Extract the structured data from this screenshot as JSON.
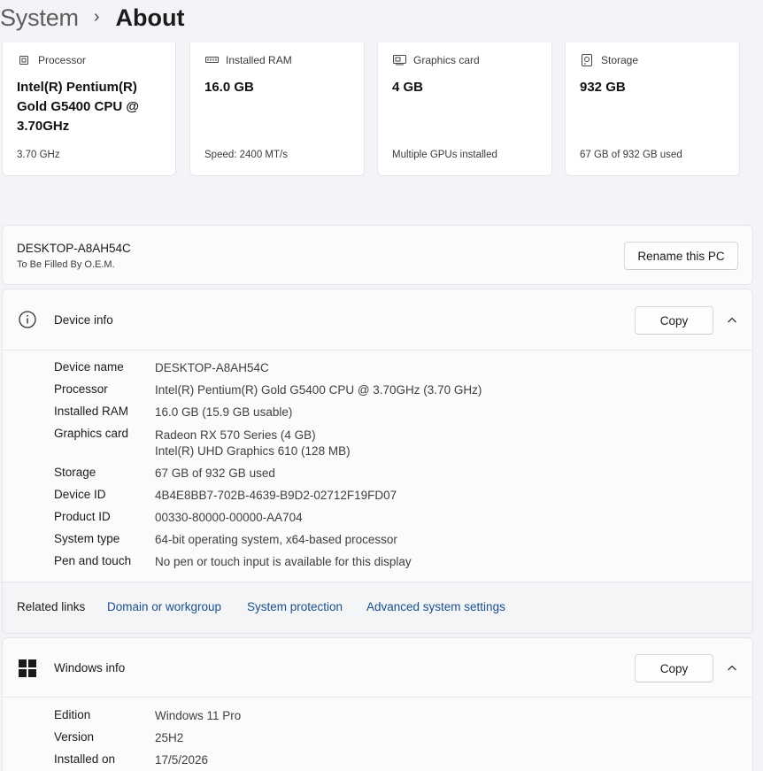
{
  "breadcrumb": {
    "parent": "System",
    "separator": "›",
    "current": "About"
  },
  "cards": [
    {
      "icon": "processor-icon",
      "label": "Processor",
      "value": "Intel(R) Pentium(R) Gold G5400 CPU @ 3.70GHz",
      "sub": "3.70 GHz"
    },
    {
      "icon": "ram-icon",
      "label": "Installed RAM",
      "value": "16.0 GB",
      "sub": "Speed: 2400 MT/s"
    },
    {
      "icon": "graphics-card-icon",
      "label": "Graphics card",
      "value": "4 GB",
      "sub": "Multiple GPUs installed"
    },
    {
      "icon": "storage-icon",
      "label": "Storage",
      "value": "932 GB",
      "sub": "67 GB of 932 GB used"
    }
  ],
  "pc": {
    "name": "DESKTOP-A8AH54C",
    "description": "To Be Filled By O.E.M.",
    "rename_label": "Rename this PC"
  },
  "device_info": {
    "title": "Device info",
    "copy_label": "Copy",
    "rows": [
      {
        "key": "Device name",
        "value": "DESKTOP-A8AH54C"
      },
      {
        "key": "Processor",
        "value": "Intel(R) Pentium(R) Gold G5400 CPU @ 3.70GHz (3.70 GHz)"
      },
      {
        "key": "Installed RAM",
        "value": "16.0 GB (15.9 GB usable)"
      },
      {
        "key": "Graphics card",
        "value": "Radeon RX 570 Series (4 GB)",
        "value2": "Intel(R) UHD Graphics 610 (128 MB)"
      },
      {
        "key": "Storage",
        "value": "67 GB of 932 GB used"
      },
      {
        "key": "Device ID",
        "value": "4B4E8BB7-702B-4639-B9D2-02712F19FD07"
      },
      {
        "key": "Product ID",
        "value": "00330-80000-00000-AA704"
      },
      {
        "key": "System type",
        "value": "64-bit operating system, x64-based processor"
      },
      {
        "key": "Pen and touch",
        "value": "No pen or touch input is available for this display"
      }
    ]
  },
  "related_links": {
    "label": "Related links",
    "links": [
      "Domain or workgroup",
      "System protection",
      "Advanced system settings"
    ]
  },
  "windows_info": {
    "title": "Windows info",
    "copy_label": "Copy",
    "rows": [
      {
        "key": "Edition",
        "value": "Windows 11 Pro"
      },
      {
        "key": "Version",
        "value": "25H2"
      },
      {
        "key": "Installed on",
        "value": "17/5/2026"
      }
    ]
  },
  "colors": {
    "link": "#1a4f8b",
    "panel": "#fbfbfc",
    "background": "#f3f4f7"
  }
}
